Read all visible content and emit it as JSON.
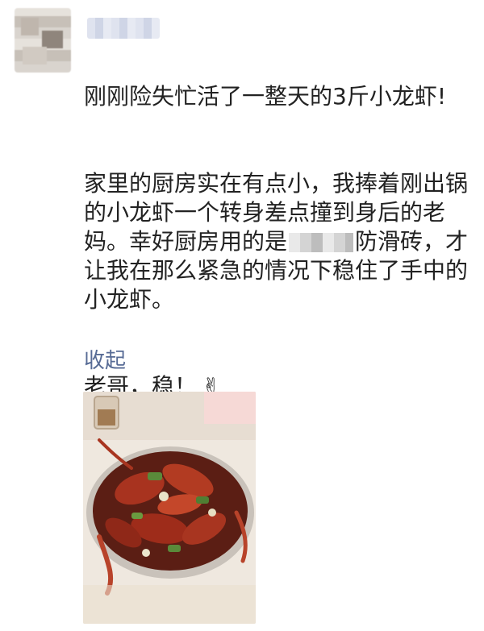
{
  "post": {
    "username_redacted": true,
    "paragraphs": [
      "刚刚险失忙活了一整天的3斤小龙虾!",
      "家里的厨房实在有点小，我捧着刚出锅的小龙虾一个转身差点撞到身后的老妈。幸好厨房用的是",
      "防滑砖，才让我在那么紧急的情况下稳住了手中的小龙虾。",
      "老哥，稳！"
    ],
    "victory_emoji": "✌",
    "collapse_label": "收起"
  },
  "colors": {
    "text": "#222222",
    "link": "#576b95",
    "background": "#ffffff"
  },
  "icons": {
    "avatar": "avatar-image",
    "emoji": "victory-hand-icon"
  }
}
